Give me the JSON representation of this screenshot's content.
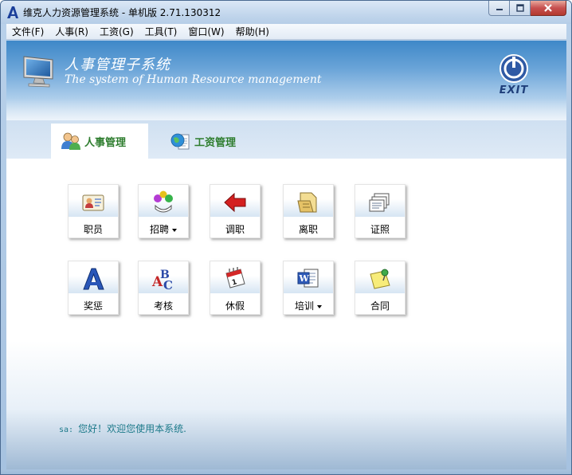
{
  "window": {
    "title": "维克人力资源管理系统 - 单机版 2.71.130312"
  },
  "menu": [
    {
      "label": "文件(F)"
    },
    {
      "label": "人事(R)"
    },
    {
      "label": "工资(G)"
    },
    {
      "label": "工具(T)"
    },
    {
      "label": "窗口(W)"
    },
    {
      "label": "帮助(H)"
    }
  ],
  "header": {
    "title": "人事管理子系统",
    "subtitle": "The system of Human Resource management",
    "exit_label": "EXIT"
  },
  "tabs": [
    {
      "label": "人事管理",
      "icon": "users-icon",
      "active": true
    },
    {
      "label": "工资管理",
      "icon": "globe-document-icon",
      "active": false
    }
  ],
  "tiles": [
    {
      "label": "职员",
      "icon": "id-card-icon",
      "dropdown": false
    },
    {
      "label": "招聘",
      "icon": "recruit-balls-icon",
      "dropdown": true
    },
    {
      "label": "调职",
      "icon": "red-arrow-icon",
      "dropdown": false
    },
    {
      "label": "离职",
      "icon": "folder-exit-icon",
      "dropdown": false
    },
    {
      "label": "证照",
      "icon": "card-stack-icon",
      "dropdown": false
    },
    {
      "label": "奖惩",
      "icon": "blue-letter-a-icon",
      "dropdown": false
    },
    {
      "label": "考核",
      "icon": "abc-letters-icon",
      "dropdown": false
    },
    {
      "label": "休假",
      "icon": "calendar-icon",
      "dropdown": false
    },
    {
      "label": "培训",
      "icon": "word-document-icon",
      "dropdown": true
    },
    {
      "label": "合同",
      "icon": "sticky-note-pin-icon",
      "dropdown": false
    }
  ],
  "status": {
    "user": "sa:",
    "message": "您好！欢迎您使用本系统."
  },
  "colors": {
    "tab_text": "#2e7d2e",
    "status_text": "#1d7a8a",
    "header_blue": "#3e88c8"
  }
}
